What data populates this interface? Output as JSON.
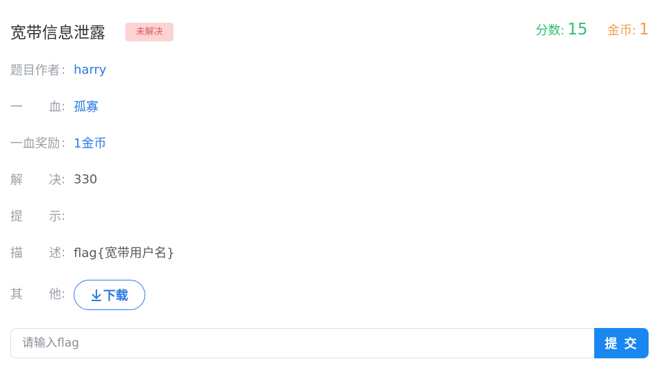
{
  "challenge": {
    "title": "宽带信息泄露",
    "status_badge": "未解决",
    "score_label": "分数:",
    "score_value": "15",
    "coin_label": "金币:",
    "coin_value": "1"
  },
  "details": {
    "author": {
      "label_parts": [
        "题目作者"
      ],
      "value": "harry"
    },
    "first_blood": {
      "label_parts": [
        "一",
        "血"
      ],
      "value": "孤寡"
    },
    "first_blood_reward": {
      "label_parts": [
        "一血奖励"
      ],
      "value": "1金币"
    },
    "solves": {
      "label_parts": [
        "解",
        "决"
      ],
      "value": "330"
    },
    "hint": {
      "label_parts": [
        "提",
        "示"
      ],
      "value": ""
    },
    "description": {
      "label_parts": [
        "描",
        "述"
      ],
      "value": "flag{宽带用户名}"
    },
    "other": {
      "label_parts": [
        "其",
        "他"
      ],
      "download_label": "下载"
    }
  },
  "colon": ":",
  "submit": {
    "placeholder": "请输入flag",
    "button_label": "提 交"
  },
  "icons": {
    "download": "download-arrow-icon"
  },
  "colors": {
    "accent": "#1a86f0",
    "score": "#2fbf6c",
    "coin": "#f0a04b",
    "badge_bg": "#fbd3d3",
    "badge_text": "#e15b5b"
  }
}
